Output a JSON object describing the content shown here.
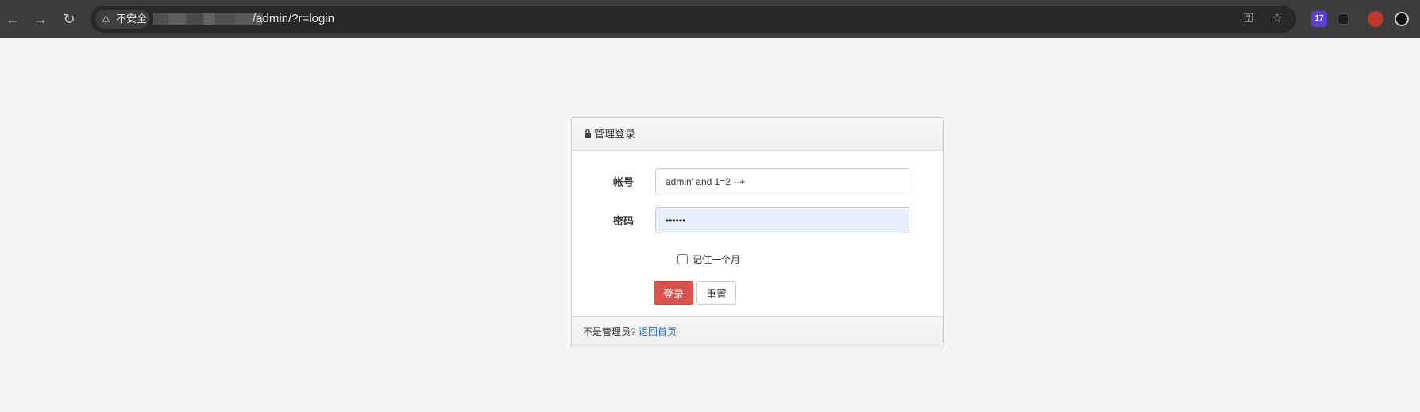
{
  "browser": {
    "security_label": "不安全",
    "url_path": "/admin/?r=login",
    "extension_badge": "17"
  },
  "colors": {
    "chrome": "#3c3c3c",
    "omnibox": "#282828",
    "login_button": "#d9534f",
    "link": "#2a6ebb"
  },
  "panel": {
    "title": "管理登录",
    "username_label": "帐号",
    "username_value": "admin' and 1=2 --+",
    "password_label": "密码",
    "password_value": "••••••",
    "remember_label": "记住一个月",
    "login_button": "登录",
    "reset_button": "重置",
    "footer_text": "不是管理员?",
    "footer_link": "返回首页"
  },
  "icons": {
    "back": "back-arrow-icon",
    "forward": "forward-arrow-icon",
    "reload": "reload-icon",
    "warning": "warning-triangle-icon",
    "key": "password-key-icon",
    "star": "bookmark-star-icon",
    "lock": "lock-icon"
  }
}
